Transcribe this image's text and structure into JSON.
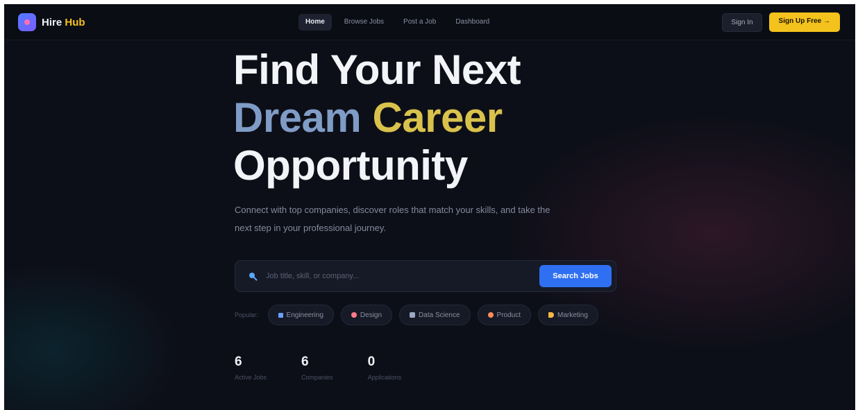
{
  "brand": {
    "name": "Hire",
    "accent": "Hub"
  },
  "nav": {
    "links": [
      "Home",
      "Browse Jobs",
      "Post a Job",
      "Dashboard"
    ],
    "active_index": 0,
    "sign_in": "Sign In",
    "sign_up": "Sign Up Free →"
  },
  "hero": {
    "line1": "Find Your Next",
    "line2_word1": "Dream",
    "line2_word2": "Career",
    "line3": "Opportunity",
    "description": "Connect with top companies, discover roles that match your skills, and take the next step in your professional journey."
  },
  "search": {
    "placeholder": "Job title, skill, or company...",
    "button": "Search Jobs"
  },
  "popular": {
    "label": "Popular:",
    "chips": [
      {
        "label": "Engineering",
        "icon": "code-icon",
        "color": "#6aa0ff"
      },
      {
        "label": "Design",
        "icon": "palette-icon",
        "color": "#ff7a8a"
      },
      {
        "label": "Data Science",
        "icon": "chart-icon",
        "color": "#9aa7c2"
      },
      {
        "label": "Product",
        "icon": "target-icon",
        "color": "#ff8a5c"
      },
      {
        "label": "Marketing",
        "icon": "megaphone-icon",
        "color": "#f5b642"
      }
    ]
  },
  "stats": [
    {
      "value": "6",
      "label": "Active Jobs"
    },
    {
      "value": "6",
      "label": "Companies"
    },
    {
      "value": "0",
      "label": "Applications"
    }
  ],
  "colors": {
    "background": "#0d0f18",
    "accent_yellow": "#f4c21c",
    "primary_blue": "#2f6ff2"
  }
}
